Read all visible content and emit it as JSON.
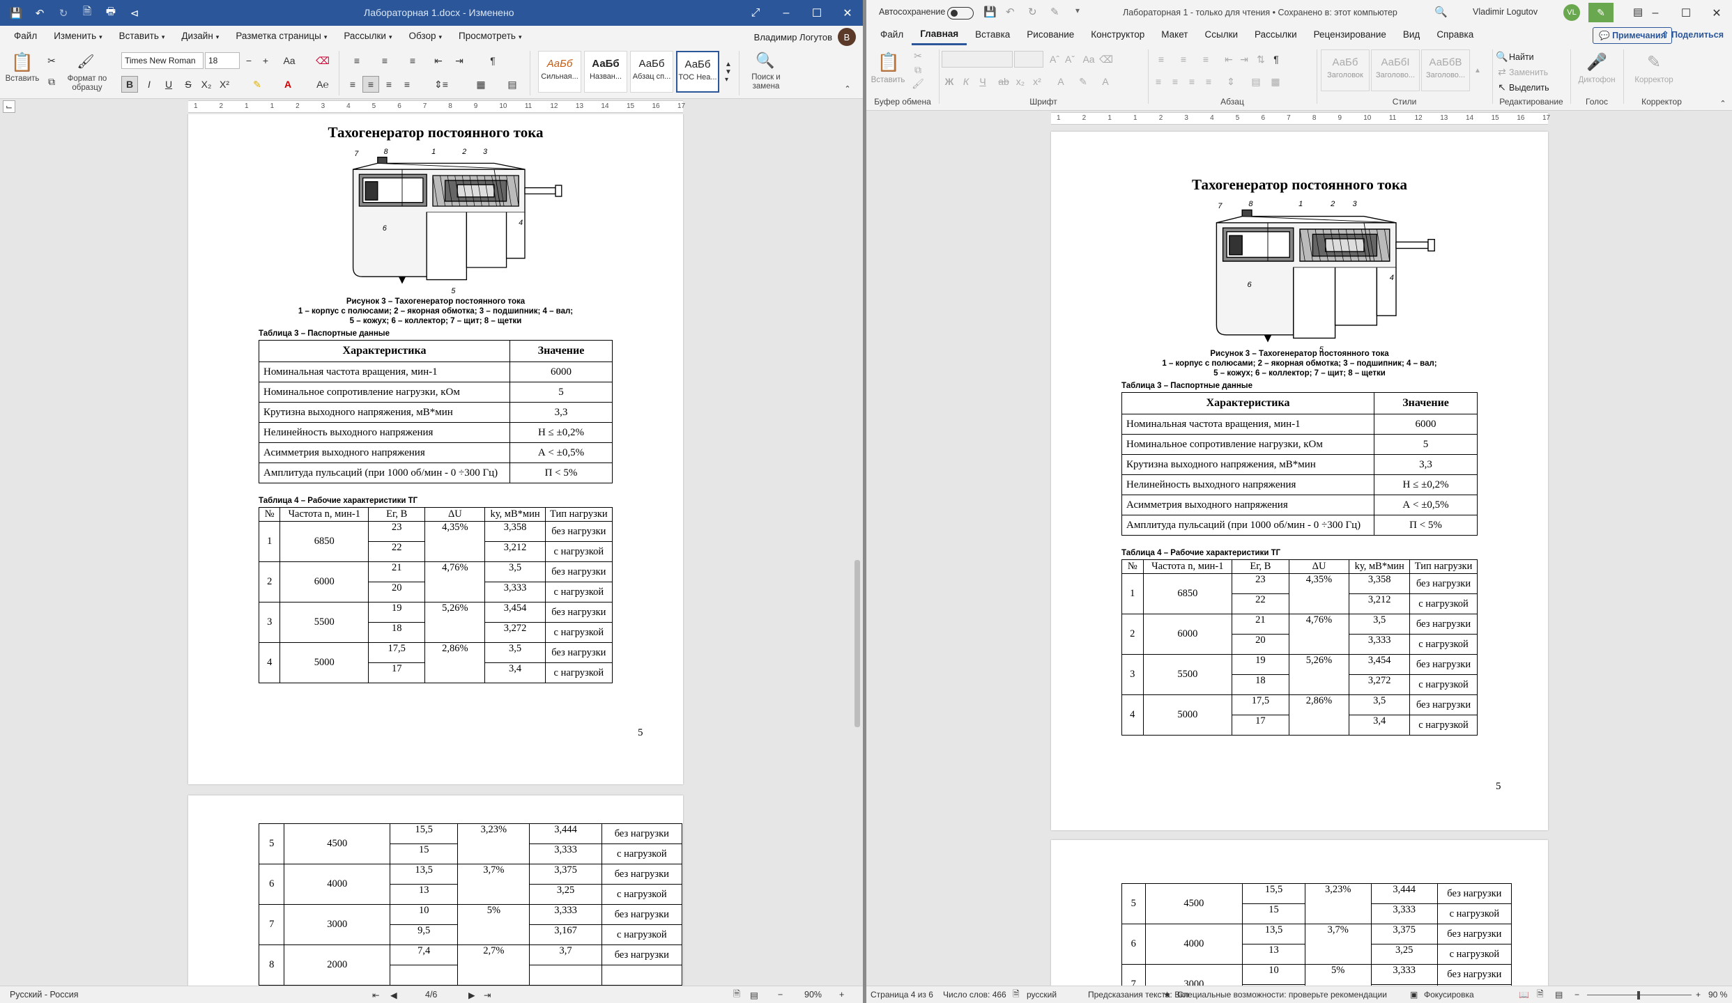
{
  "left": {
    "title": "Лабораторная 1.docx - Изменено",
    "tabs": [
      {
        "label": "Файл",
        "dd": false
      },
      {
        "label": "Изменить",
        "dd": true
      },
      {
        "label": "Вставить",
        "dd": true
      },
      {
        "label": "Дизайн",
        "dd": true
      },
      {
        "label": "Разметка страницы",
        "dd": true
      },
      {
        "label": "Рассылки",
        "dd": true
      },
      {
        "label": "Обзор",
        "dd": true
      },
      {
        "label": "Просмотреть",
        "dd": true
      }
    ],
    "user": "Владимир Логутов",
    "avatar": "В",
    "ribbon": {
      "paste": "Вставить",
      "format_painter": "Формат по образцу",
      "font": "Times New Roman",
      "size": "18",
      "styles": [
        {
          "preview": "АаБб",
          "name": "Сильная..."
        },
        {
          "preview": "АаБб",
          "name": "Назван..."
        },
        {
          "preview": "АаБб",
          "name": "Абзац сп..."
        },
        {
          "preview": "АаБб",
          "name": "ТОС Нea..."
        }
      ],
      "find": "Поиск и замена"
    },
    "ruler_nums": [
      "1",
      "2",
      "1",
      "1",
      "2",
      "3",
      "4",
      "5",
      "6",
      "7",
      "8",
      "9",
      "10",
      "11",
      "12",
      "13",
      "14",
      "15",
      "16",
      "17"
    ],
    "status": {
      "lang": "Русский - Россия",
      "page": "4/6",
      "zoom": "90%"
    }
  },
  "right": {
    "autosave": "Автосохранение",
    "title": "Лабораторная 1 - только для чтения • Сохранено в: этот компьютер",
    "user": "Vladimir Logutov",
    "avatar": "VL",
    "tabs": [
      "Файл",
      "Главная",
      "Вставка",
      "Рисование",
      "Конструктор",
      "Макет",
      "Ссылки",
      "Рассылки",
      "Рецензирование",
      "Вид",
      "Справка"
    ],
    "comments": "Примечания",
    "share": "Поделиться",
    "ribbon": {
      "paste": "Вставить",
      "find": "Найти",
      "replace": "Заменить",
      "select": "Выделить",
      "dictate": "Диктофон",
      "editor": "Корректор",
      "styles": [
        {
          "preview": "АаБб",
          "name": "Заголовок"
        },
        {
          "preview": "АаБбI",
          "name": "Заголово..."
        },
        {
          "preview": "АаБбВ",
          "name": "Заголово..."
        }
      ],
      "groups": [
        "Буфер обмена",
        "Шрифт",
        "Абзац",
        "Стили",
        "Редактирование",
        "Голос",
        "Корректор"
      ]
    },
    "status": {
      "page": "Страница 4 из 6",
      "words": "Число слов: 466",
      "lang": "русский",
      "predict": "Предсказания текста: Вкл",
      "access": "Специальные возможности: проверьте рекомендации",
      "focus": "Фокусировка",
      "zoom": "90 %"
    }
  },
  "doc": {
    "title": "Тахогенератор постоянного тока",
    "fig_caption": [
      "Рисунок 3 – Тахогенератор постоянного тока",
      "1 – корпус с полюсами; 2 – якорная обмотка; 3 – подшипник; 4 – вал;",
      "5 – кожух; 6 – коллектор; 7 – щит; 8 – щетки"
    ],
    "fig_labels": [
      "7",
      "8",
      "1",
      "2",
      "3",
      "6",
      "4",
      "5"
    ],
    "table3_caption": "Таблица 3 – Паспортные данные",
    "table3_head": [
      "Характеристика",
      "Значение"
    ],
    "table3_rows": [
      [
        "Номинальная частота вращения, мин-1",
        "6000"
      ],
      [
        "Номинальное сопротивление нагрузки, кОм",
        "5"
      ],
      [
        "Крутизна выходного напряжения, мВ*мин",
        "3,3"
      ],
      [
        "Нелинейность выходного напряжения",
        "Н ≤ ±0,2%"
      ],
      [
        "Асимметрия выходного напряжения",
        "А < ±0,5%"
      ],
      [
        "Амплитуда пульсаций (при 1000 об/мин - 0 ÷300 Гц)",
        "П < 5%"
      ]
    ],
    "table4_caption": "Таблица 4 – Рабочие характеристики ТГ",
    "table4_head": [
      "№",
      "Частота n, мин-1",
      "Ег, В",
      "ΔU",
      "kу, мВ*мин",
      "Тип нагрузки"
    ],
    "table4_rows": [
      {
        "n": "1",
        "f": "6850",
        "du": "4,35%",
        "a": [
          "23",
          "3,358",
          "без нагрузки"
        ],
        "b": [
          "22",
          "3,212",
          "с нагрузкой"
        ]
      },
      {
        "n": "2",
        "f": "6000",
        "du": "4,76%",
        "a": [
          "21",
          "3,5",
          "без нагрузки"
        ],
        "b": [
          "20",
          "3,333",
          "с нагрузкой"
        ]
      },
      {
        "n": "3",
        "f": "5500",
        "du": "5,26%",
        "a": [
          "19",
          "3,454",
          "без нагрузки"
        ],
        "b": [
          "18",
          "3,272",
          "с нагрузкой"
        ]
      },
      {
        "n": "4",
        "f": "5000",
        "du": "2,86%",
        "a": [
          "17,5",
          "3,5",
          "без нагрузки"
        ],
        "b": [
          "17",
          "3,4",
          "с нагрузкой"
        ]
      }
    ],
    "table4_cont_left": [
      {
        "n": "5",
        "f": "4500",
        "du": "3,23%",
        "a": [
          "15,5",
          "3,444",
          "без нагрузки"
        ],
        "b": [
          "15",
          "3,333",
          "с нагрузкой"
        ]
      },
      {
        "n": "6",
        "f": "4000",
        "du": "3,7%",
        "a": [
          "13,5",
          "3,375",
          "без нагрузки"
        ],
        "b": [
          "13",
          "3,25",
          "с нагрузкой"
        ]
      },
      {
        "n": "7",
        "f": "3000",
        "du": "5%",
        "a": [
          "10",
          "3,333",
          "без нагрузки"
        ],
        "b": [
          "9,5",
          "3,167",
          "с нагрузкой"
        ]
      },
      {
        "n": "8",
        "f": "2000",
        "du": "2,7%",
        "a": [
          "7,4",
          "3,7",
          "без нагрузки"
        ],
        "b": [
          "",
          "",
          ""
        ]
      }
    ],
    "table4_cont_right": [
      {
        "n": "5",
        "f": "4500",
        "du": "3,23%",
        "a": [
          "15,5",
          "3,444",
          "без нагрузки"
        ],
        "b": [
          "15",
          "3,333",
          "с нагрузкой"
        ]
      },
      {
        "n": "6",
        "f": "4000",
        "du": "3,7%",
        "a": [
          "13,5",
          "3,375",
          "без нагрузки"
        ],
        "b": [
          "13",
          "3,25",
          "с нагрузкой"
        ]
      },
      {
        "n": "7",
        "f": "3000",
        "du": "5%",
        "a": [
          "10",
          "3,333",
          "без нагрузки"
        ],
        "b": [
          "",
          "",
          ""
        ]
      }
    ],
    "page_num": "5"
  }
}
